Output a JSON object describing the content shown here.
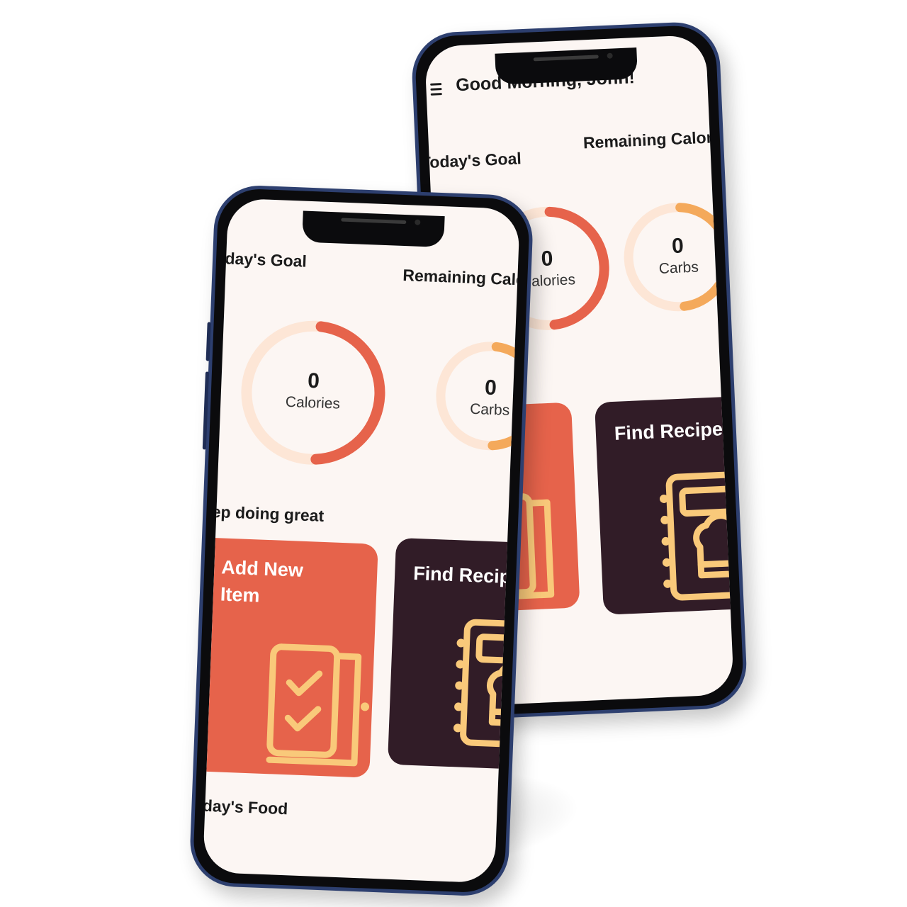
{
  "app": {
    "greeting": "Good Morning, John!",
    "todays_goal_label": "Today's Goal",
    "remaining_label": "Remaining Calories",
    "motivation": "Keep doing great",
    "todays_food_label": "Today's Food"
  },
  "rings": [
    {
      "value": "0",
      "unit": "Calories",
      "progress": 0.5,
      "color": "#e6634b",
      "track": "#fde6d6"
    },
    {
      "value": "0",
      "unit": "Carbs",
      "progress": 0.5,
      "color": "#f4a95b",
      "track": "#fde6d6"
    }
  ],
  "cards": [
    {
      "title_line1": "Add New",
      "title_line2": "Item",
      "color": "#e6634b",
      "icon": "checklist-icon"
    },
    {
      "title": "Find Recipes",
      "color": "#311c27",
      "icon": "recipe-book-icon"
    }
  ],
  "colors": {
    "background": "#fcf6f3",
    "accent": "#e6634b",
    "dark": "#311c27",
    "icon_line": "#f9c97a",
    "frame": "#2d3f6f"
  }
}
